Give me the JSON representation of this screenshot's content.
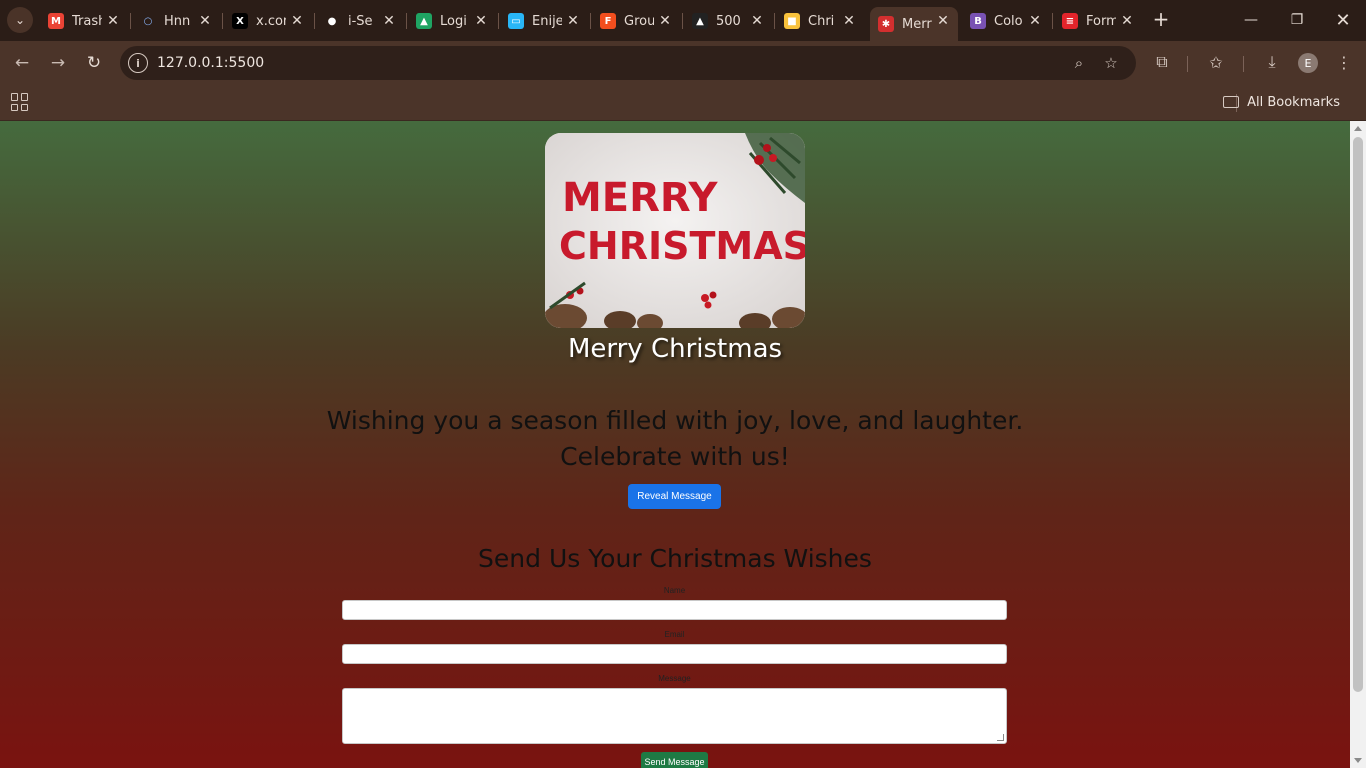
{
  "browser": {
    "tabs": [
      {
        "title": "Trash",
        "favicon": "gmail-icon",
        "color": "#ea4335",
        "letter": "M"
      },
      {
        "title": "Hnn",
        "favicon": "loading-icon",
        "color": "#5f6368",
        "letter": "○"
      },
      {
        "title": "x.com",
        "favicon": "x-icon",
        "color": "#000000",
        "letter": "X"
      },
      {
        "title": "i-Se",
        "favicon": "github-icon",
        "color": "#ffffff",
        "letter": "●"
      },
      {
        "title": "Logi",
        "favicon": "google-drive-icon",
        "color": "#1fa463",
        "letter": "▲"
      },
      {
        "title": "Enije",
        "favicon": "window-icon",
        "color": "#29b6f6",
        "letter": "▭"
      },
      {
        "title": "Grou",
        "favicon": "figma-icon",
        "color": "#f24e1e",
        "letter": "F"
      },
      {
        "title": "500",
        "favicon": "mountain-icon",
        "color": "#222222",
        "letter": "▲"
      },
      {
        "title": "Chri",
        "favicon": "candle-icon",
        "color": "#f9c23c",
        "letter": "■"
      },
      {
        "title": "Merr",
        "favicon": "santa-icon",
        "color": "#d32f2f",
        "letter": "✱",
        "active": true
      },
      {
        "title": "Colo",
        "favicon": "bootstrap-icon",
        "color": "#7952b3",
        "letter": "B"
      },
      {
        "title": "Form",
        "favicon": "forms-icon",
        "color": "#e3242b",
        "letter": "≡"
      }
    ],
    "url": "127.0.0.1:5500",
    "all_bookmarks": "All Bookmarks",
    "profile_letter": "E"
  },
  "page": {
    "image_text_line1": "MERRY",
    "image_text_line2": "CHRISTMAS",
    "title": "Merry Christmas",
    "greeting": "Wishing you a season filled with joy, love, and laughter. Celebrate with us!",
    "reveal_button": "Reveal Message",
    "form_heading": "Send Us Your Christmas Wishes",
    "name_label": "Name",
    "email_label": "Email",
    "message_label": "Message",
    "send_button": "Send Message"
  }
}
